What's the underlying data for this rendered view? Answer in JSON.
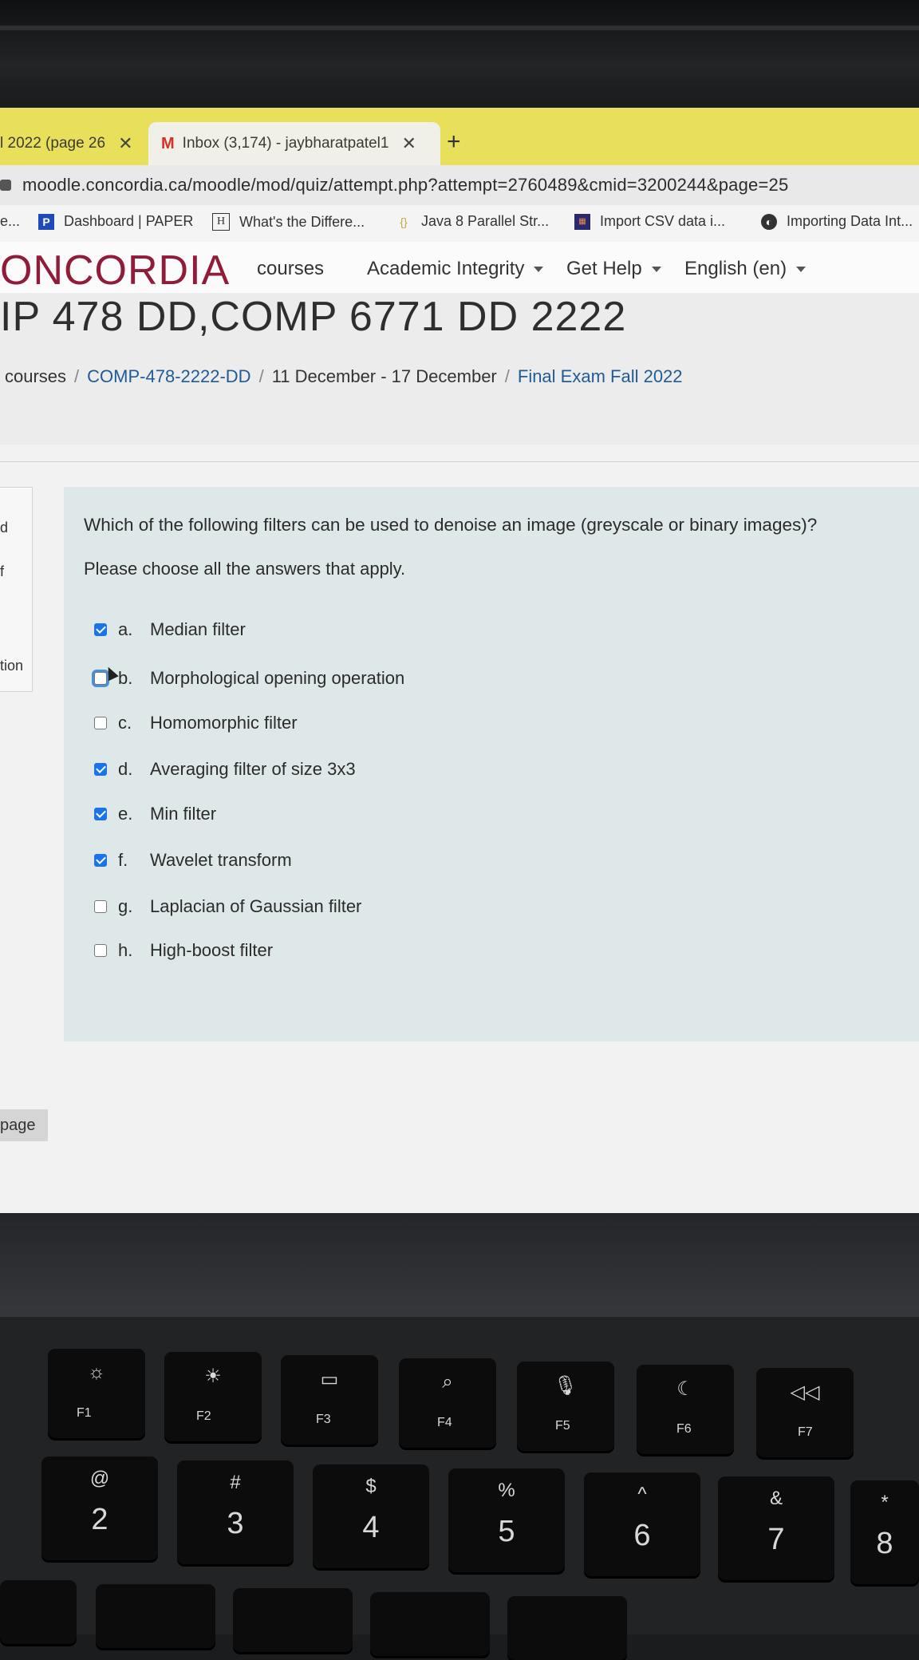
{
  "browser": {
    "tabs": [
      {
        "label": "l 2022 (page 26",
        "close": "✕"
      },
      {
        "label": "Inbox (3,174) - jaybharatpatel1",
        "close": "✕"
      }
    ],
    "new_tab": "+",
    "url": "moodle.concordia.ca/moodle/mod/quiz/attempt.php?attempt=2760489&cmid=3200244&page=25",
    "bookmarks": [
      {
        "label": "e...",
        "icon": "generic"
      },
      {
        "label": "Dashboard | PAPER",
        "icon": "P"
      },
      {
        "label": "What's the Differe...",
        "icon": "H"
      },
      {
        "label": "Java 8 Parallel Str...",
        "icon": "java"
      },
      {
        "label": "Import CSV data i...",
        "icon": "csv"
      },
      {
        "label": "Importing Data Int...",
        "icon": "globe"
      }
    ]
  },
  "site": {
    "brand": "ONCORDIA",
    "nav": {
      "courses": "courses",
      "academic_integrity": "Academic Integrity",
      "get_help": "Get Help",
      "language": "English (en)"
    },
    "brand_color": "#8f1d3a"
  },
  "course": {
    "title": "IP 478 DD,COMP 6771 DD 2222",
    "breadcrumb": [
      "courses",
      "COMP-478-2222-DD",
      "11 December - 17 December",
      "Final Exam Fall 2022"
    ]
  },
  "left_nav": [
    "d",
    "f",
    "tion"
  ],
  "question": {
    "text": "Which of the following filters can be used to denoise an image (greyscale or binary images)?",
    "prompt": "Please choose all the answers that apply.",
    "options": [
      {
        "letter": "a.",
        "label": "Median filter",
        "checked": true
      },
      {
        "letter": "b.",
        "label": "Morphological opening operation",
        "checked": false
      },
      {
        "letter": "c.",
        "label": "Homomorphic filter",
        "checked": false
      },
      {
        "letter": "d.",
        "label": "Averaging filter of size 3x3",
        "checked": true
      },
      {
        "letter": "e.",
        "label": "Min filter",
        "checked": true
      },
      {
        "letter": "f.",
        "label": "Wavelet transform",
        "checked": true
      },
      {
        "letter": "g.",
        "label": "Laplacian of Gaussian filter",
        "checked": false
      },
      {
        "letter": "h.",
        "label": "High-boost filter",
        "checked": false
      }
    ]
  },
  "next_page": "page",
  "keyboard": {
    "fn_keys": [
      "F1",
      "F2",
      "F3",
      "F4",
      "F5",
      "F6",
      "F7"
    ],
    "fn_icons": [
      "brightness-down-icon",
      "brightness-up-icon",
      "mission-control-icon",
      "search-icon",
      "microphone-icon",
      "moon-icon",
      "rewind-icon"
    ],
    "num_keys": [
      {
        "sym": "@",
        "num": "2"
      },
      {
        "sym": "#",
        "num": "3"
      },
      {
        "sym": "$",
        "num": "4"
      },
      {
        "sym": "%",
        "num": "5"
      },
      {
        "sym": "^",
        "num": "6"
      },
      {
        "sym": "&",
        "num": "7"
      },
      {
        "sym": "*",
        "num": "8"
      }
    ]
  }
}
